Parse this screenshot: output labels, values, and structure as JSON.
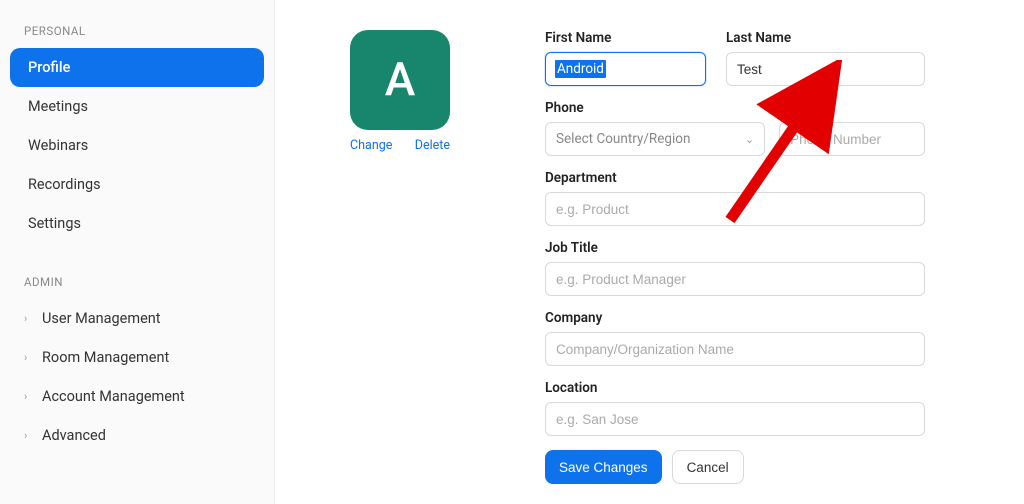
{
  "sidebar": {
    "personal_label": "PERSONAL",
    "admin_label": "ADMIN",
    "personal_items": [
      {
        "label": "Profile",
        "active": true
      },
      {
        "label": "Meetings"
      },
      {
        "label": "Webinars"
      },
      {
        "label": "Recordings"
      },
      {
        "label": "Settings"
      }
    ],
    "admin_items": [
      {
        "label": "User Management"
      },
      {
        "label": "Room Management"
      },
      {
        "label": "Account Management"
      },
      {
        "label": "Advanced"
      }
    ]
  },
  "avatar": {
    "letter": "A",
    "change": "Change",
    "delete": "Delete",
    "color": "#18866d"
  },
  "form": {
    "first_name_label": "First Name",
    "first_name_value": "Android",
    "last_name_label": "Last Name",
    "last_name_value": "Test",
    "phone_label": "Phone",
    "phone_select_placeholder": "Select Country/Region",
    "phone_number_placeholder": "Phone Number",
    "department_label": "Department",
    "department_placeholder": "e.g. Product",
    "job_title_label": "Job Title",
    "job_title_placeholder": "e.g. Product Manager",
    "company_label": "Company",
    "company_placeholder": "Company/Organization Name",
    "location_label": "Location",
    "location_placeholder": "e.g. San Jose",
    "save_label": "Save Changes",
    "cancel_label": "Cancel"
  },
  "colors": {
    "accent": "#0e72ed",
    "arrow": "#e30000"
  }
}
